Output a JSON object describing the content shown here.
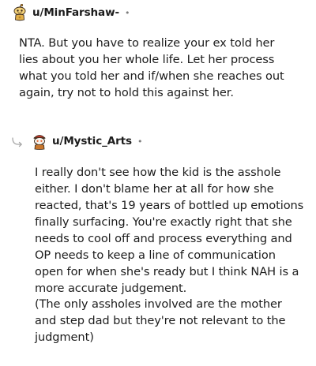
{
  "comments": [
    {
      "username": "u/MinFarshaw-",
      "separator": "•",
      "avatar_icon": "gold-snoo-avatar-icon",
      "body": "NTA. But you have to realize your ex told her lies about you her whole life. Let her process what you told her and if/when she reaches out again, try not to hold this against her."
    },
    {
      "username": "u/Mystic_Arts",
      "separator": "•",
      "avatar_icon": "pirate-snoo-avatar-icon",
      "reply_icon": "reply-arrow-icon",
      "paragraphs": [
        "I really don't see how the kid is the asshole either. I don't blame her at all for how she reacted, that's 19 years of bottled up emotions finally surfacing. You're exactly right that she needs to cool off and process everything and OP needs to keep a line of communication open for when she's ready but I think NAH is a more accurate judgement.",
        "(The only assholes involved are the mother and step dad but they're not relevant to the judgment)"
      ]
    }
  ],
  "colors": {
    "text": "#1c1c1c",
    "muted": "#7c7c7c",
    "background": "#ffffff"
  }
}
